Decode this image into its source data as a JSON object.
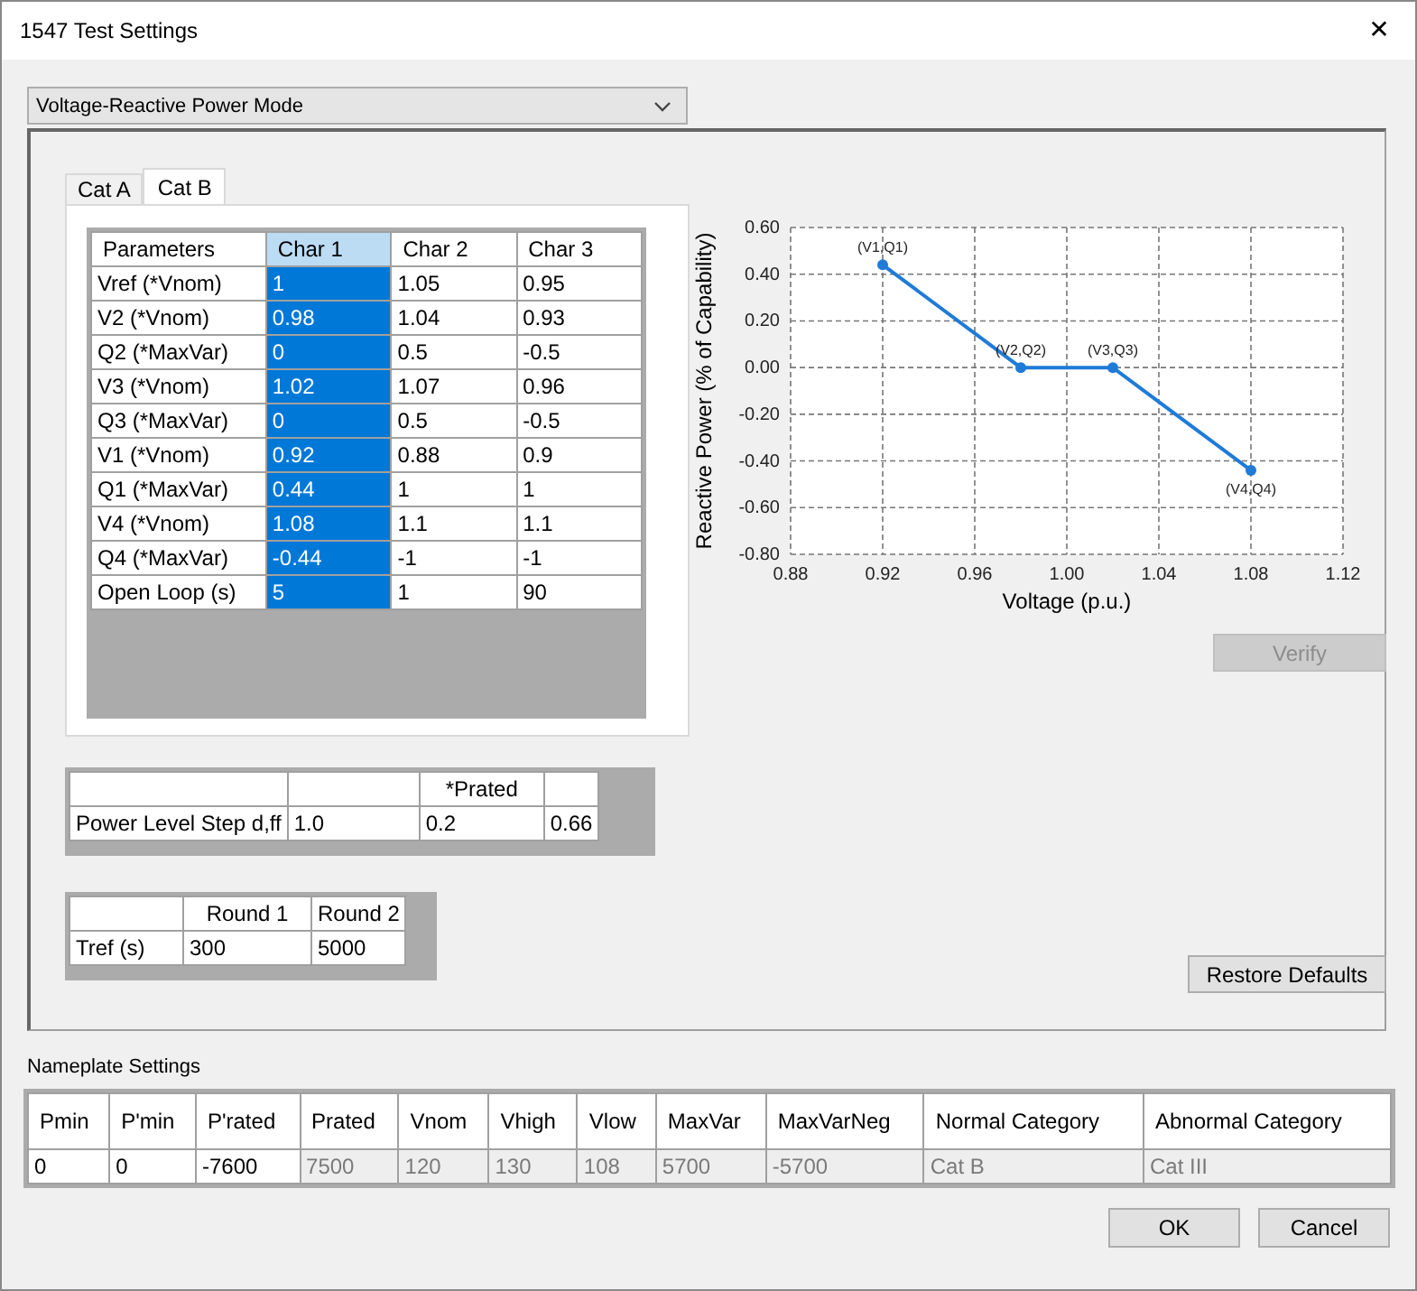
{
  "window": {
    "title": "1547 Test Settings",
    "close_glyph": "✕"
  },
  "mode_dropdown": {
    "value": "Voltage-Reactive Power Mode"
  },
  "tabs": [
    {
      "label": "Cat A",
      "selected": false
    },
    {
      "label": "Cat B",
      "selected": true
    }
  ],
  "characteristics_table": {
    "columns": [
      {
        "label": "Parameters",
        "selected": false
      },
      {
        "label": "Char 1",
        "selected": true
      },
      {
        "label": "Char 2",
        "selected": false
      },
      {
        "label": "Char 3",
        "selected": false
      }
    ],
    "rows": [
      {
        "parameter": "Vref (*Vnom)",
        "values": [
          "1",
          "1.05",
          "0.95"
        ]
      },
      {
        "parameter": "V2 (*Vnom)",
        "values": [
          "0.98",
          "1.04",
          "0.93"
        ]
      },
      {
        "parameter": "Q2 (*MaxVar)",
        "values": [
          "0",
          "0.5",
          "-0.5"
        ]
      },
      {
        "parameter": "V3 (*Vnom)",
        "values": [
          "1.02",
          "1.07",
          "0.96"
        ]
      },
      {
        "parameter": "Q3 (*MaxVar)",
        "values": [
          "0",
          "0.5",
          "-0.5"
        ]
      },
      {
        "parameter": "V1 (*Vnom)",
        "values": [
          "0.92",
          "0.88",
          "0.9"
        ]
      },
      {
        "parameter": "Q1 (*MaxVar)",
        "values": [
          "0.44",
          "1",
          "1"
        ]
      },
      {
        "parameter": "V4 (*Vnom)",
        "values": [
          "1.08",
          "1.1",
          "1.1"
        ]
      },
      {
        "parameter": "Q4 (*MaxVar)",
        "values": [
          "-0.44",
          "-1",
          "-1"
        ]
      },
      {
        "parameter": "Open Loop (s)",
        "values": [
          "5",
          "1",
          "90"
        ]
      }
    ]
  },
  "chart_data": {
    "type": "line",
    "xlabel": "Voltage (p.u.)",
    "ylabel": "Reactive Power (% of Capability)",
    "x": [
      0.92,
      0.98,
      1.02,
      1.08
    ],
    "series": [
      {
        "color": "#1e7bd8",
        "marker": "circle",
        "values": [
          0.44,
          0,
          0,
          -0.44
        ]
      }
    ],
    "grid": true,
    "value_labels": [
      "(V1,Q1)",
      "(V2,Q2)",
      "(V3,Q3)",
      "(V4,Q4)"
    ],
    "xlim": [
      0.88,
      1.12
    ],
    "ylim": [
      -0.8,
      0.6
    ],
    "xticks": [
      {
        "value": 0.88,
        "label": "0.88"
      },
      {
        "value": 0.92,
        "label": "0.92"
      },
      {
        "value": 0.96,
        "label": "0.96"
      },
      {
        "value": 1.0,
        "label": "1.00"
      },
      {
        "value": 1.04,
        "label": "1.04"
      },
      {
        "value": 1.08,
        "label": "1.08"
      },
      {
        "value": 1.12,
        "label": "1.12"
      }
    ],
    "yticks": [
      {
        "value": 0.6,
        "label": "0.60"
      },
      {
        "value": 0.4,
        "label": "0.40"
      },
      {
        "value": 0.2,
        "label": "0.20"
      },
      {
        "value": 0,
        "label": "0.00"
      },
      {
        "value": -0.2,
        "label": "-0.20"
      },
      {
        "value": -0.4,
        "label": "-0.40"
      },
      {
        "value": -0.6,
        "label": "-0.60"
      },
      {
        "value": -0.8,
        "label": "-0.80"
      }
    ]
  },
  "verify_button": {
    "label": "Verify",
    "disabled": true
  },
  "power_level_table": {
    "columns": [
      {},
      {},
      {
        "label": "*Prated"
      },
      {}
    ],
    "rows": [
      {
        "label": "Power Level Step d,ff",
        "values": [
          "1.0",
          "0.2",
          "0.66"
        ]
      }
    ]
  },
  "tref_table": {
    "columns": [
      {},
      {
        "label": "Round 1"
      },
      {
        "label": "Round 2"
      }
    ],
    "rows": [
      {
        "label": "Tref (s)",
        "values": [
          "300",
          "5000"
        ]
      }
    ]
  },
  "restore_defaults_button": {
    "label": "Restore Defaults"
  },
  "nameplate": {
    "title": "Nameplate Settings",
    "columns": [
      {
        "label": "Pmin",
        "value": "0",
        "disabled": false
      },
      {
        "label": "P'min",
        "value": "0",
        "disabled": false
      },
      {
        "label": "P'rated",
        "value": "-7600",
        "disabled": false
      },
      {
        "label": "Prated",
        "value": "7500",
        "disabled": true
      },
      {
        "label": "Vnom",
        "value": "120",
        "disabled": true
      },
      {
        "label": "Vhigh",
        "value": "130",
        "disabled": true
      },
      {
        "label": "Vlow",
        "value": "108",
        "disabled": true
      },
      {
        "label": "MaxVar",
        "value": "5700",
        "disabled": true
      },
      {
        "label": "MaxVarNeg",
        "value": "-5700",
        "disabled": true
      },
      {
        "label": "Normal Category",
        "value": "Cat B",
        "disabled": true
      },
      {
        "label": "Abnormal Category",
        "value": "Cat III",
        "disabled": true
      }
    ]
  },
  "buttons": [
    {
      "label": "OK"
    },
    {
      "label": "Cancel"
    }
  ]
}
